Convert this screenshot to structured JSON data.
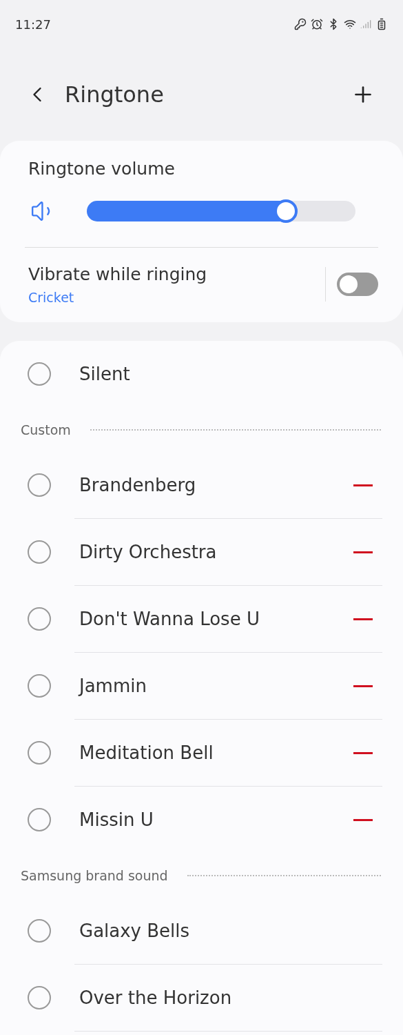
{
  "status_bar": {
    "time": "11:27"
  },
  "header": {
    "title": "Ringtone"
  },
  "volume": {
    "label": "Ringtone volume",
    "level": 0.74
  },
  "vibrate": {
    "label": "Vibrate while ringing",
    "value": "Cricket",
    "on": false
  },
  "list": [
    {
      "kind": "option",
      "label": "Silent",
      "selected": false,
      "removable": false
    },
    {
      "kind": "header",
      "label": "Custom"
    },
    {
      "kind": "option",
      "label": "Brandenberg",
      "selected": false,
      "removable": true
    },
    {
      "kind": "option",
      "label": "Dirty Orchestra",
      "selected": false,
      "removable": true
    },
    {
      "kind": "option",
      "label": "Don't Wanna Lose U",
      "selected": false,
      "removable": true
    },
    {
      "kind": "option",
      "label": "Jammin",
      "selected": false,
      "removable": true
    },
    {
      "kind": "option",
      "label": "Meditation Bell",
      "selected": false,
      "removable": true
    },
    {
      "kind": "option",
      "label": "Missin U",
      "selected": false,
      "removable": true
    },
    {
      "kind": "header",
      "label": "Samsung brand sound"
    },
    {
      "kind": "option",
      "label": "Galaxy Bells",
      "selected": false,
      "removable": false
    },
    {
      "kind": "option",
      "label": "Over the Horizon",
      "selected": false,
      "removable": false
    }
  ]
}
